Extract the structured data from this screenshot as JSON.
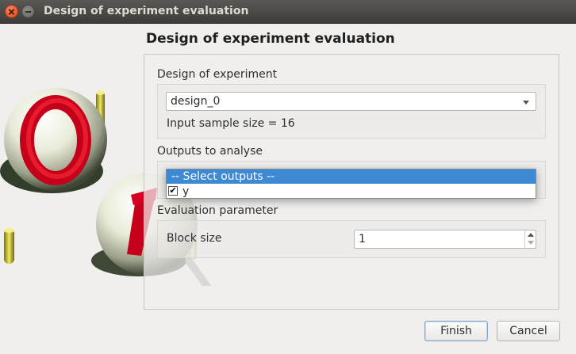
{
  "window": {
    "title": "Design of experiment evaluation"
  },
  "page": {
    "title": "Design of experiment evaluation"
  },
  "doe_section": {
    "label": "Design of experiment",
    "selected_design": "design_0",
    "sample_size_text": "Input sample size = 16"
  },
  "outputs_section": {
    "label": "Outputs to analyse",
    "dropdown": {
      "header_option": "-- Select outputs --",
      "options": [
        {
          "label": "y",
          "checked": true,
          "check_glyph": "✔"
        }
      ]
    }
  },
  "eval_section": {
    "label": "Evaluation parameter",
    "block_size_label": "Block size",
    "block_size_value": "1"
  },
  "buttons": {
    "finish": "Finish",
    "cancel": "Cancel"
  },
  "icons": {
    "close": "close-icon",
    "minimize": "minimize-icon",
    "combo_arrow": "chevron-down-icon"
  },
  "colors": {
    "selection": "#3d89d4",
    "title_bar": "#3d3c39",
    "close_button": "#e1491a"
  }
}
